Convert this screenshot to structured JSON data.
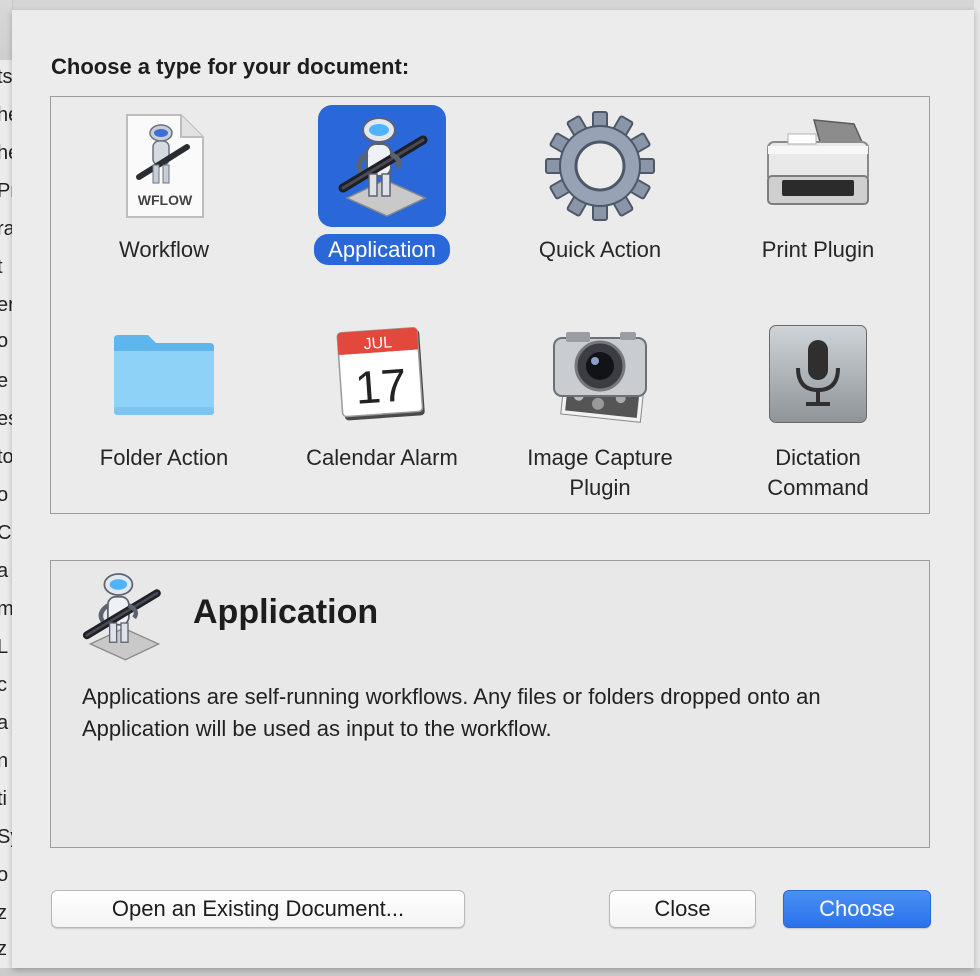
{
  "dialog": {
    "prompt": "Choose a type for your document:"
  },
  "types": [
    {
      "label": "Workflow",
      "icon": "workflow-document-icon",
      "badge": "WFLOW"
    },
    {
      "label": "Application",
      "icon": "automator-robot-icon",
      "selected": true
    },
    {
      "label": "Quick Action",
      "icon": "gear-icon"
    },
    {
      "label": "Print Plugin",
      "icon": "printer-icon"
    },
    {
      "label": "Folder Action",
      "icon": "folder-icon"
    },
    {
      "label": "Calendar Alarm",
      "icon": "calendar-icon",
      "month": "JUL",
      "day": "17"
    },
    {
      "label": "Image Capture Plugin",
      "label_lines": [
        "Image Capture",
        "Plugin"
      ],
      "icon": "camera-icon"
    },
    {
      "label": "Dictation Command",
      "label_lines": [
        "Dictation",
        "Command"
      ],
      "icon": "microphone-icon"
    }
  ],
  "description": {
    "title": "Application",
    "text": "Applications are self-running workflows. Any files or folders dropped onto an Application will be used as input to the workflow."
  },
  "buttons": {
    "open_existing": "Open an Existing Document...",
    "close": "Close",
    "choose": "Choose"
  },
  "colors": {
    "selection": "#2a67d8",
    "primary_button": "#2a72ec"
  },
  "background": {
    "left_fragments": [
      "ts",
      "he",
      "he",
      "Pr",
      "ra",
      "t",
      "er",
      "o",
      "e",
      "es",
      "to",
      "o",
      "C",
      "a",
      "m",
      "L",
      "c",
      "a",
      "n",
      "ti",
      "Sy",
      "o",
      "z",
      "z"
    ]
  }
}
